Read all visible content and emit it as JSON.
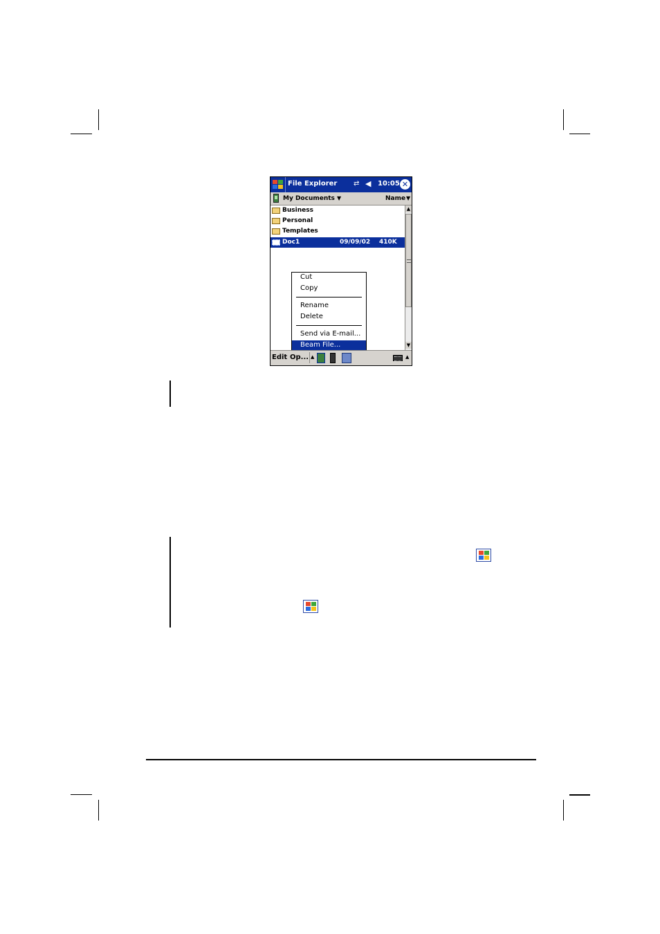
{
  "window": {
    "title": "File Explorer",
    "clock": "10:05",
    "close_glyph": "✕",
    "connectivity_icon": "connectivity-icon",
    "speaker_icon": "speaker-mute-icon"
  },
  "folderbar": {
    "folder": "My Documents",
    "sort": "Name"
  },
  "files": [
    {
      "name": "Business",
      "type": "folder"
    },
    {
      "name": "Personal",
      "type": "folder"
    },
    {
      "name": "Templates",
      "type": "folder"
    },
    {
      "name": "Doc1",
      "type": "document",
      "date": "09/09/02",
      "size": "410K",
      "selected": true
    }
  ],
  "context_menu": {
    "items": [
      "Cut",
      "Copy",
      "Rename",
      "Delete",
      "Send via E-mail...",
      "Beam File..."
    ],
    "selected": "Beam File..."
  },
  "command_bar": {
    "edit": "Edit",
    "open": "Op..."
  },
  "colors": {
    "titlebar": "#0b2f9c",
    "chrome": "#d6d3ce",
    "selection": "#0b2f9c"
  }
}
